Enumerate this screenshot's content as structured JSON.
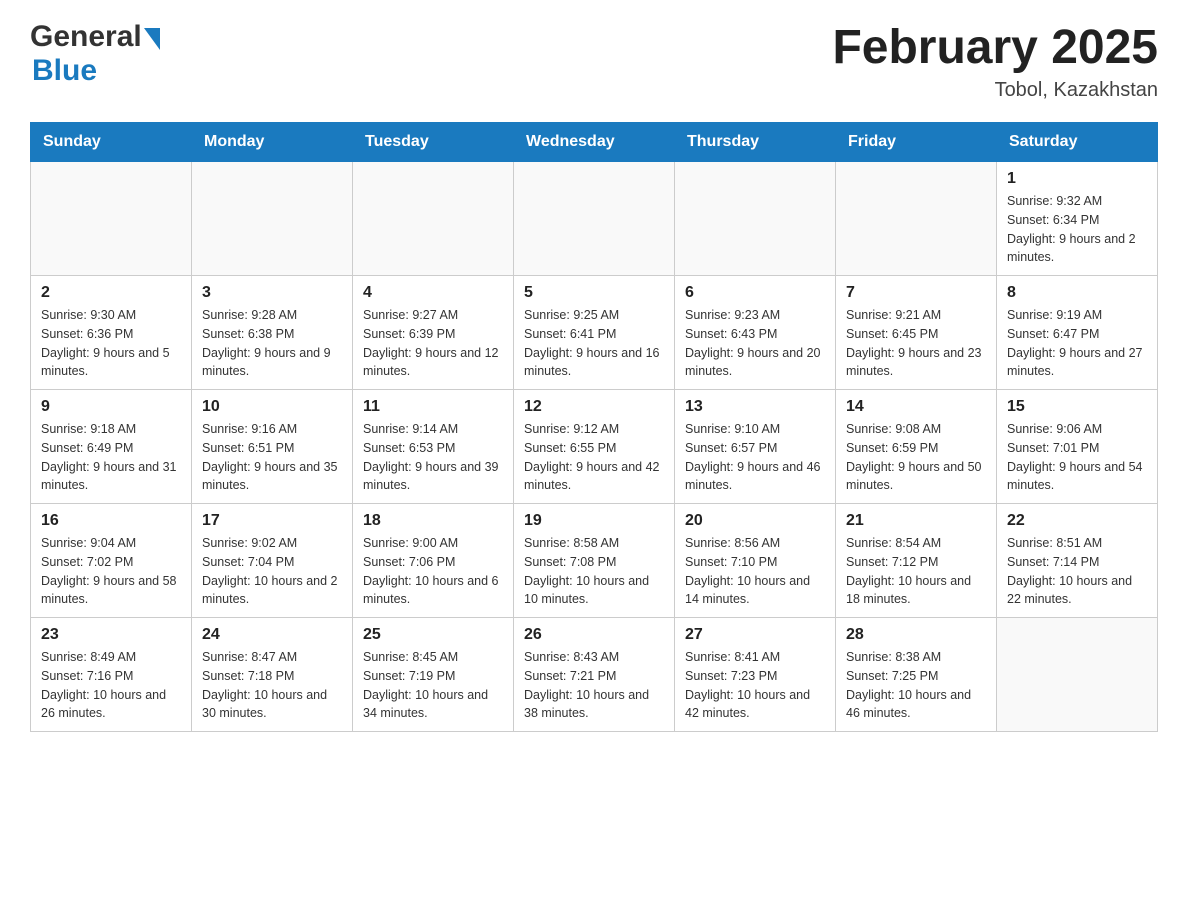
{
  "header": {
    "logo_general": "General",
    "logo_blue": "Blue",
    "title": "February 2025",
    "subtitle": "Tobol, Kazakhstan"
  },
  "days_of_week": [
    "Sunday",
    "Monday",
    "Tuesday",
    "Wednesday",
    "Thursday",
    "Friday",
    "Saturday"
  ],
  "weeks": [
    [
      {
        "day": "",
        "sunrise": "",
        "sunset": "",
        "daylight": ""
      },
      {
        "day": "",
        "sunrise": "",
        "sunset": "",
        "daylight": ""
      },
      {
        "day": "",
        "sunrise": "",
        "sunset": "",
        "daylight": ""
      },
      {
        "day": "",
        "sunrise": "",
        "sunset": "",
        "daylight": ""
      },
      {
        "day": "",
        "sunrise": "",
        "sunset": "",
        "daylight": ""
      },
      {
        "day": "",
        "sunrise": "",
        "sunset": "",
        "daylight": ""
      },
      {
        "day": "1",
        "sunrise": "Sunrise: 9:32 AM",
        "sunset": "Sunset: 6:34 PM",
        "daylight": "Daylight: 9 hours and 2 minutes."
      }
    ],
    [
      {
        "day": "2",
        "sunrise": "Sunrise: 9:30 AM",
        "sunset": "Sunset: 6:36 PM",
        "daylight": "Daylight: 9 hours and 5 minutes."
      },
      {
        "day": "3",
        "sunrise": "Sunrise: 9:28 AM",
        "sunset": "Sunset: 6:38 PM",
        "daylight": "Daylight: 9 hours and 9 minutes."
      },
      {
        "day": "4",
        "sunrise": "Sunrise: 9:27 AM",
        "sunset": "Sunset: 6:39 PM",
        "daylight": "Daylight: 9 hours and 12 minutes."
      },
      {
        "day": "5",
        "sunrise": "Sunrise: 9:25 AM",
        "sunset": "Sunset: 6:41 PM",
        "daylight": "Daylight: 9 hours and 16 minutes."
      },
      {
        "day": "6",
        "sunrise": "Sunrise: 9:23 AM",
        "sunset": "Sunset: 6:43 PM",
        "daylight": "Daylight: 9 hours and 20 minutes."
      },
      {
        "day": "7",
        "sunrise": "Sunrise: 9:21 AM",
        "sunset": "Sunset: 6:45 PM",
        "daylight": "Daylight: 9 hours and 23 minutes."
      },
      {
        "day": "8",
        "sunrise": "Sunrise: 9:19 AM",
        "sunset": "Sunset: 6:47 PM",
        "daylight": "Daylight: 9 hours and 27 minutes."
      }
    ],
    [
      {
        "day": "9",
        "sunrise": "Sunrise: 9:18 AM",
        "sunset": "Sunset: 6:49 PM",
        "daylight": "Daylight: 9 hours and 31 minutes."
      },
      {
        "day": "10",
        "sunrise": "Sunrise: 9:16 AM",
        "sunset": "Sunset: 6:51 PM",
        "daylight": "Daylight: 9 hours and 35 minutes."
      },
      {
        "day": "11",
        "sunrise": "Sunrise: 9:14 AM",
        "sunset": "Sunset: 6:53 PM",
        "daylight": "Daylight: 9 hours and 39 minutes."
      },
      {
        "day": "12",
        "sunrise": "Sunrise: 9:12 AM",
        "sunset": "Sunset: 6:55 PM",
        "daylight": "Daylight: 9 hours and 42 minutes."
      },
      {
        "day": "13",
        "sunrise": "Sunrise: 9:10 AM",
        "sunset": "Sunset: 6:57 PM",
        "daylight": "Daylight: 9 hours and 46 minutes."
      },
      {
        "day": "14",
        "sunrise": "Sunrise: 9:08 AM",
        "sunset": "Sunset: 6:59 PM",
        "daylight": "Daylight: 9 hours and 50 minutes."
      },
      {
        "day": "15",
        "sunrise": "Sunrise: 9:06 AM",
        "sunset": "Sunset: 7:01 PM",
        "daylight": "Daylight: 9 hours and 54 minutes."
      }
    ],
    [
      {
        "day": "16",
        "sunrise": "Sunrise: 9:04 AM",
        "sunset": "Sunset: 7:02 PM",
        "daylight": "Daylight: 9 hours and 58 minutes."
      },
      {
        "day": "17",
        "sunrise": "Sunrise: 9:02 AM",
        "sunset": "Sunset: 7:04 PM",
        "daylight": "Daylight: 10 hours and 2 minutes."
      },
      {
        "day": "18",
        "sunrise": "Sunrise: 9:00 AM",
        "sunset": "Sunset: 7:06 PM",
        "daylight": "Daylight: 10 hours and 6 minutes."
      },
      {
        "day": "19",
        "sunrise": "Sunrise: 8:58 AM",
        "sunset": "Sunset: 7:08 PM",
        "daylight": "Daylight: 10 hours and 10 minutes."
      },
      {
        "day": "20",
        "sunrise": "Sunrise: 8:56 AM",
        "sunset": "Sunset: 7:10 PM",
        "daylight": "Daylight: 10 hours and 14 minutes."
      },
      {
        "day": "21",
        "sunrise": "Sunrise: 8:54 AM",
        "sunset": "Sunset: 7:12 PM",
        "daylight": "Daylight: 10 hours and 18 minutes."
      },
      {
        "day": "22",
        "sunrise": "Sunrise: 8:51 AM",
        "sunset": "Sunset: 7:14 PM",
        "daylight": "Daylight: 10 hours and 22 minutes."
      }
    ],
    [
      {
        "day": "23",
        "sunrise": "Sunrise: 8:49 AM",
        "sunset": "Sunset: 7:16 PM",
        "daylight": "Daylight: 10 hours and 26 minutes."
      },
      {
        "day": "24",
        "sunrise": "Sunrise: 8:47 AM",
        "sunset": "Sunset: 7:18 PM",
        "daylight": "Daylight: 10 hours and 30 minutes."
      },
      {
        "day": "25",
        "sunrise": "Sunrise: 8:45 AM",
        "sunset": "Sunset: 7:19 PM",
        "daylight": "Daylight: 10 hours and 34 minutes."
      },
      {
        "day": "26",
        "sunrise": "Sunrise: 8:43 AM",
        "sunset": "Sunset: 7:21 PM",
        "daylight": "Daylight: 10 hours and 38 minutes."
      },
      {
        "day": "27",
        "sunrise": "Sunrise: 8:41 AM",
        "sunset": "Sunset: 7:23 PM",
        "daylight": "Daylight: 10 hours and 42 minutes."
      },
      {
        "day": "28",
        "sunrise": "Sunrise: 8:38 AM",
        "sunset": "Sunset: 7:25 PM",
        "daylight": "Daylight: 10 hours and 46 minutes."
      },
      {
        "day": "",
        "sunrise": "",
        "sunset": "",
        "daylight": ""
      }
    ]
  ]
}
